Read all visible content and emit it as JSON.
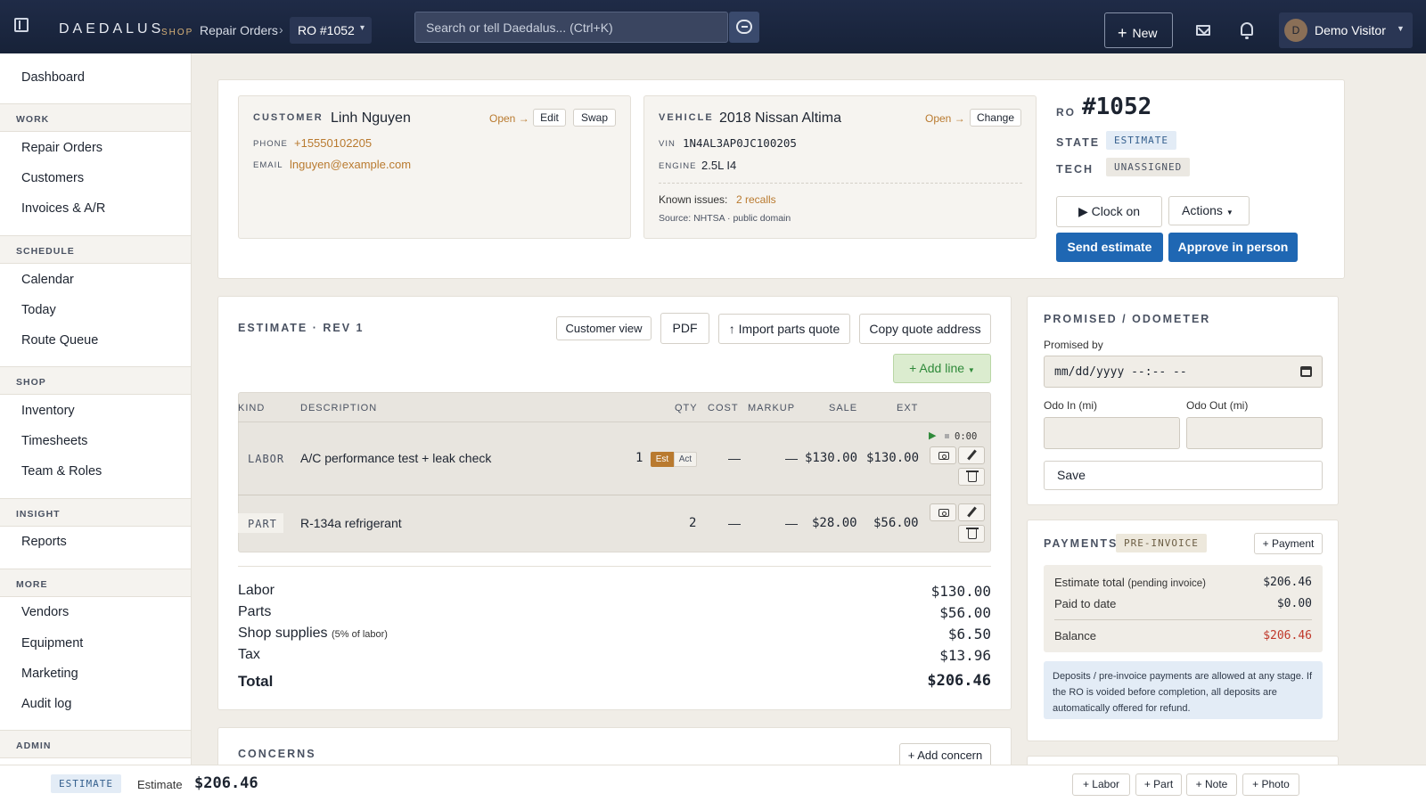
{
  "topbar": {
    "brand": "DAEDALUS",
    "brand_sub": "SHOP",
    "breadcrumb": "Repair Orders",
    "ro_selector": "RO #1052",
    "search_placeholder": "Search or tell Daedalus... (Ctrl+K)",
    "new_label": "New",
    "user_initial": "D",
    "user_name": "Demo Visitor"
  },
  "sidebar": {
    "top_item": "Dashboard",
    "groups": [
      {
        "title": "WORK",
        "items": [
          "Repair Orders",
          "Customers",
          "Invoices & A/R"
        ]
      },
      {
        "title": "SCHEDULE",
        "items": [
          "Calendar",
          "Today",
          "Route Queue"
        ]
      },
      {
        "title": "SHOP",
        "items": [
          "Inventory",
          "Timesheets",
          "Team & Roles"
        ]
      },
      {
        "title": "INSIGHT",
        "items": [
          "Reports"
        ]
      },
      {
        "title": "MORE",
        "items": [
          "Vendors",
          "Equipment",
          "Marketing",
          "Audit log"
        ]
      },
      {
        "title": "ADMIN",
        "items": []
      }
    ]
  },
  "customer": {
    "label": "CUSTOMER",
    "name": "Linh Nguyen",
    "open": "Open →",
    "edit": "Edit",
    "swap": "Swap",
    "phone_label": "PHONE",
    "phone": "+15550102205",
    "email_label": "EMAIL",
    "email": "lnguyen@example.com"
  },
  "vehicle": {
    "label": "VEHICLE",
    "name": "2018 Nissan Altima",
    "open": "Open →",
    "change": "Change",
    "vin_label": "VIN",
    "vin": "1N4AL3AP0JC100205",
    "engine_label": "ENGINE",
    "engine": "2.5L I4",
    "known_issues_label": "Known issues:",
    "known_issues": "2 recalls",
    "source": "Source: NHTSA · public domain"
  },
  "ro": {
    "label": "RO",
    "number": "#1052",
    "state_label": "STATE",
    "state": "ESTIMATE",
    "tech_label": "TECH",
    "tech": "UNASSIGNED",
    "clock_on": "▶ Clock on",
    "actions": "Actions",
    "send_estimate": "Send estimate",
    "approve": "Approve in person"
  },
  "estimate": {
    "title": "ESTIMATE · REV 1",
    "customer_view": "Customer view",
    "pdf": "PDF",
    "import_parts": "↑ Import parts quote",
    "copy_quote": "Copy quote address",
    "add_line": "+ Add line",
    "columns": [
      "KIND",
      "DESCRIPTION",
      "QTY",
      "COST",
      "MARKUP",
      "SALE",
      "EXT"
    ],
    "lines": [
      {
        "kind": "LABOR",
        "description": "A/C performance test + leak check",
        "qty": "1",
        "est": "Est",
        "act": "Act",
        "cost": "—",
        "markup": "—",
        "sale": "$130.00",
        "ext": "$130.00",
        "timer": "0:00"
      },
      {
        "kind": "PART",
        "description": "R-134a refrigerant",
        "qty": "2",
        "cost": "—",
        "markup": "—",
        "sale": "$28.00",
        "ext": "$56.00"
      }
    ],
    "totals": [
      {
        "label": "Labor",
        "note": "",
        "value": "$130.00"
      },
      {
        "label": "Parts",
        "note": "",
        "value": "$56.00"
      },
      {
        "label": "Shop supplies",
        "note": "(5% of labor)",
        "value": "$6.50"
      },
      {
        "label": "Tax",
        "note": "",
        "value": "$13.96"
      }
    ],
    "total_label": "Total",
    "total_value": "$206.46"
  },
  "concerns": {
    "title": "CONCERNS",
    "add": "+ Add concern"
  },
  "promised": {
    "title": "PROMISED / ODOMETER",
    "promised_by": "Promised by",
    "date_placeholder": "mm/dd/yyyy --:-- --",
    "odo_in": "Odo In (mi)",
    "odo_out": "Odo Out (mi)",
    "save": "Save"
  },
  "payments": {
    "title": "PAYMENTS",
    "badge": "PRE-INVOICE",
    "add": "+ Payment",
    "estimate_total_label": "Estimate total",
    "estimate_total_note": "(pending invoice)",
    "estimate_total": "$206.46",
    "paid_label": "Paid to date",
    "paid": "$0.00",
    "balance_label": "Balance",
    "balance": "$206.46",
    "info": "Deposits / pre-invoice payments are allowed at any stage. If the RO is voided before completion, all deposits are automatically offered for refund."
  },
  "bottombar": {
    "state": "ESTIMATE",
    "label": "Estimate",
    "amount": "$206.46",
    "labor": "+ Labor",
    "part": "+ Part",
    "note": "+ Note",
    "photo": "+ Photo"
  },
  "colors": {
    "topbar": "#1f2b47",
    "accent_blue": "#1f67b3",
    "link_orange": "#b97a2f",
    "balance_red": "#c0392b",
    "add_line_green": "#2f8a3a"
  }
}
